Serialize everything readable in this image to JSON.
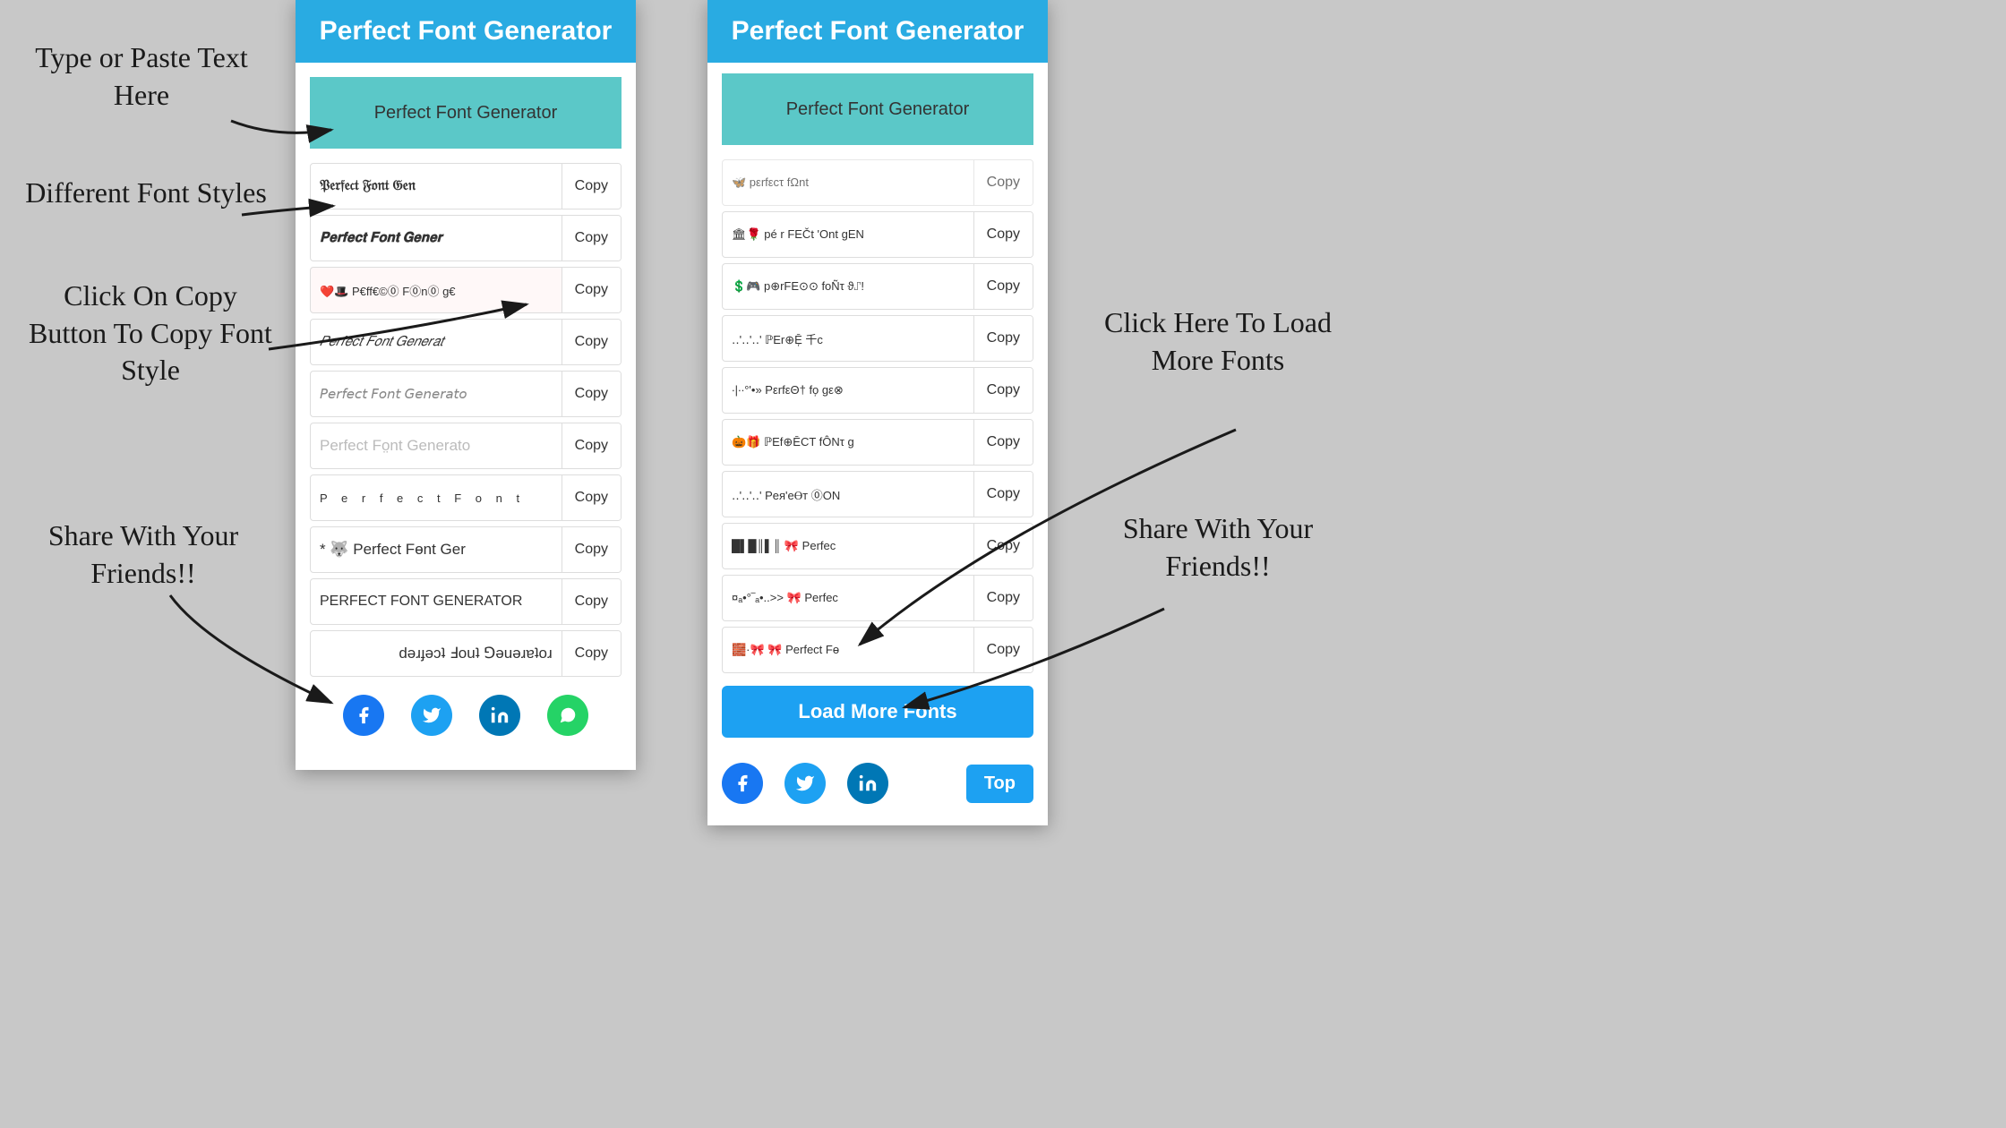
{
  "title": "Perfect Font Generator",
  "annotations": {
    "type_paste": "Type or Paste Text\nHere",
    "different_fonts": "Different Font\nStyles",
    "click_copy": "Click On Copy\nButton To Copy\nFont Style",
    "share_left": "Share With\nYour\nFriends!!",
    "click_load": "Click Here To\nLoad More\nFonts",
    "share_right": "Share With\nYour\nFriends!!"
  },
  "input_placeholder": "Perfect Font Generator",
  "header_label": "Perfect Font Generator",
  "copy_label": "Copy",
  "load_more_label": "Load More Fonts",
  "top_label": "Top",
  "font_rows_left": [
    {
      "text": "𝔓𝔢𝔯𝔣𝔢𝔠𝔱 𝔉𝔬𝔫𝔱 𝔊𝔢𝔫𝔢𝔯𝔞𝔱𝔬𝔯",
      "style": "font-bold-old"
    },
    {
      "text": "𝐏𝐞𝐫𝐟𝐞𝐜𝐭 𝐅𝐨𝐧𝐭 𝐆𝐞𝐧𝐞𝐫𝐚𝐭𝐨𝐫",
      "style": "font-blackletter"
    },
    {
      "text": "❤️🎩 P€ff€©⓪ F⓪n⓪ g€",
      "style": "font-unicode"
    },
    {
      "text": "𝑃𝑒𝑟𝑓𝑒𝑐𝑡 𝐹𝑜𝑛𝑡 𝐺𝑒𝑛𝑒𝑟𝑎𝑡",
      "style": "font-italic-serif"
    },
    {
      "text": "𝘗𝘦𝘳𝘧𝘦𝘤𝘵 𝘍𝘰𝘯𝘵 𝘎𝘦𝘯𝘦𝘳𝘢𝘵𝘰",
      "style": "font-italic-sans"
    },
    {
      "text": "Perfect Fӧnt Generator",
      "style": ""
    },
    {
      "text": "P e r f e c t  F o n t",
      "style": "font-spaced"
    },
    {
      "text": "* 🐺 Perfect Fɵnt Ger",
      "style": ""
    },
    {
      "text": "PERFECT FONT GENERATOR",
      "style": "font-small-caps"
    },
    {
      "text": "ɹoʇɐɹǝuǝ⅁ ʇuoℲ ʇɔǝɟɹǝd",
      "style": ""
    }
  ],
  "font_rows_right_top": [
    {
      "text": "🦋🐞 ρεrfεcτ fΩnt gεη",
      "style": "font-unicode"
    },
    {
      "text": "💲🎮 p⊕rFE⊙⊙ foÑτ ϑ⑀!",
      "style": "font-unicode"
    },
    {
      "text": "‥'‥'‥' ℙEr⊕Ē᷊ 千c",
      "style": "font-unicode"
    },
    {
      "text": "∙|∙∙°'•» PεrfεΘ† fo᷊ gε⊗",
      "style": "font-unicode"
    },
    {
      "text": "🎃🎁 ℙEf⊕ĒCT fÔNτ g",
      "style": "font-unicode"
    },
    {
      "text": "‥'‥'‥' Peя'eⲐт ⓪ON",
      "style": "font-unicode"
    },
    {
      "text": "█▌█║▌║ 🎀 Perfec",
      "style": "font-unicode"
    },
    {
      "text": "¤ₐ•°‾ₐ•..>>  🎀  Perfec",
      "style": "font-unicode"
    },
    {
      "text": "🧱·🎀 🎀 Perfect Fɵ",
      "style": "font-unicode"
    }
  ],
  "social_icons": [
    "facebook",
    "twitter",
    "linkedin",
    "whatsapp"
  ],
  "colors": {
    "header_bg": "#29abe2",
    "input_bg": "#5bc8c8",
    "load_more_bg": "#1da1f2",
    "top_btn_bg": "#1da1f2",
    "facebook": "#1877f2",
    "twitter": "#1da1f2",
    "linkedin": "#0077b5",
    "whatsapp": "#25d366"
  }
}
